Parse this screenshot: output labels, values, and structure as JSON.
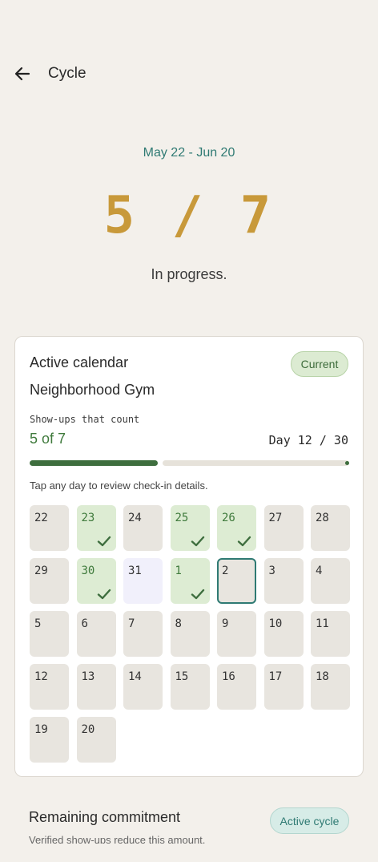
{
  "header": {
    "title": "Cycle",
    "back_icon": "arrow-left-icon"
  },
  "cycle": {
    "date_range": "May 22 - Jun 20",
    "progress_display": "5 / 7",
    "status": "In progress."
  },
  "calendar_card": {
    "title": "Active calendar",
    "badge": "Current",
    "gym_name": "Neighborhood Gym",
    "showups_label": "Show-ups that count",
    "showups_value": "5 of 7",
    "day_counter": "Day 12 / 30",
    "progress_fraction": 0.4,
    "hint": "Tap any day to review check-in details.",
    "days": [
      {
        "label": "22",
        "state": "past"
      },
      {
        "label": "23",
        "state": "done"
      },
      {
        "label": "24",
        "state": "past"
      },
      {
        "label": "25",
        "state": "done"
      },
      {
        "label": "26",
        "state": "done"
      },
      {
        "label": "27",
        "state": "past"
      },
      {
        "label": "28",
        "state": "past"
      },
      {
        "label": "29",
        "state": "past"
      },
      {
        "label": "30",
        "state": "done"
      },
      {
        "label": "31",
        "state": "future"
      },
      {
        "label": "1",
        "state": "done"
      },
      {
        "label": "2",
        "state": "today"
      },
      {
        "label": "3",
        "state": "past"
      },
      {
        "label": "4",
        "state": "past"
      },
      {
        "label": "5",
        "state": "past"
      },
      {
        "label": "6",
        "state": "past"
      },
      {
        "label": "7",
        "state": "past"
      },
      {
        "label": "8",
        "state": "past"
      },
      {
        "label": "9",
        "state": "past"
      },
      {
        "label": "10",
        "state": "past"
      },
      {
        "label": "11",
        "state": "past"
      },
      {
        "label": "12",
        "state": "past"
      },
      {
        "label": "13",
        "state": "past"
      },
      {
        "label": "14",
        "state": "past"
      },
      {
        "label": "15",
        "state": "past"
      },
      {
        "label": "16",
        "state": "past"
      },
      {
        "label": "17",
        "state": "past"
      },
      {
        "label": "18",
        "state": "past"
      },
      {
        "label": "19",
        "state": "past"
      },
      {
        "label": "20",
        "state": "past"
      }
    ],
    "colors": {
      "accent_teal": "#2f7a73",
      "progress_green": "#3e6e3e",
      "big_number_gold": "#c8993a",
      "done_cell": "#ddecd3"
    }
  },
  "remaining": {
    "title": "Remaining commitment",
    "badge": "Active cycle",
    "subtitle": "Verified show-ups reduce this amount."
  }
}
